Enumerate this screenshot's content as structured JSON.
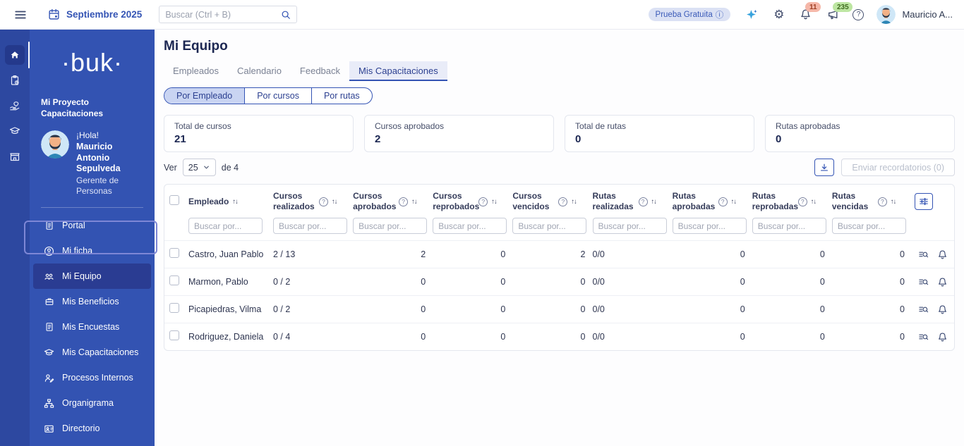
{
  "icons": {
    "sort": "↑↓",
    "help": "?",
    "info": "ⓘ",
    "gear": "⚙"
  },
  "topbar": {
    "date": "Septiembre 2025",
    "search": {
      "placeholder": "Buscar (Ctrl + B)"
    },
    "trial_badge": "Prueba Gratuita",
    "notifications_count": "11",
    "announcements_count": "235",
    "user_name": "Mauricio A..."
  },
  "sidebar": {
    "logo": "·buk·",
    "project_title": "Mi Proyecto Capacitaciones",
    "greeting": "¡Hola!",
    "user_name_line1": "Mauricio Antonio",
    "user_name_line2": "Sepulveda",
    "user_role": "Gerente de Personas",
    "items": [
      {
        "label": "Portal"
      },
      {
        "label": "Mi ficha"
      },
      {
        "label": "Mi Equipo"
      },
      {
        "label": "Mis Beneficios"
      },
      {
        "label": "Mis Encuestas"
      },
      {
        "label": "Mis Capacitaciones"
      },
      {
        "label": "Procesos Internos"
      },
      {
        "label": "Organigrama"
      },
      {
        "label": "Directorio"
      }
    ]
  },
  "main": {
    "page_title": "Mi Equipo",
    "tabs": [
      {
        "label": "Empleados"
      },
      {
        "label": "Calendario"
      },
      {
        "label": "Feedback"
      },
      {
        "label": "Mis Capacitaciones"
      }
    ],
    "view_toggle": [
      {
        "label": "Por Empleado"
      },
      {
        "label": "Por cursos"
      },
      {
        "label": "Por rutas"
      }
    ],
    "stats": [
      {
        "label": "Total de cursos",
        "value": "21"
      },
      {
        "label": "Cursos aprobados",
        "value": "2"
      },
      {
        "label": "Total de rutas",
        "value": "0"
      },
      {
        "label": "Rutas aprobadas",
        "value": "0"
      }
    ],
    "toolbar": {
      "ver_label": "Ver",
      "page_size": "25",
      "total_label": "de 4",
      "send_reminders_label": "Enviar recordatorios (0)"
    },
    "table": {
      "filter_placeholder": "Buscar por...",
      "columns": [
        {
          "label": "Empleado"
        },
        {
          "label": "Cursos realizados"
        },
        {
          "label": "Cursos aprobados"
        },
        {
          "label": "Cursos reprobados"
        },
        {
          "label": "Cursos vencidos"
        },
        {
          "label": "Rutas realizadas"
        },
        {
          "label": "Rutas aprobadas"
        },
        {
          "label": "Rutas reprobadas"
        },
        {
          "label": "Rutas vencidas"
        }
      ],
      "rows": [
        {
          "employee": "Castro, Juan Pablo",
          "cursos_realizados": "2 / 13",
          "cursos_aprobados": "2",
          "cursos_reprobados": "0",
          "cursos_vencidos": "2",
          "rutas_realizadas": "0/0",
          "rutas_aprobadas": "0",
          "rutas_reprobadas": "0",
          "rutas_vencidas": "0"
        },
        {
          "employee": "Marmon, Pablo",
          "cursos_realizados": "0 / 2",
          "cursos_aprobados": "0",
          "cursos_reprobados": "0",
          "cursos_vencidos": "0",
          "rutas_realizadas": "0/0",
          "rutas_aprobadas": "0",
          "rutas_reprobadas": "0",
          "rutas_vencidas": "0"
        },
        {
          "employee": "Picapiedras, Vilma",
          "cursos_realizados": "0 / 2",
          "cursos_aprobados": "0",
          "cursos_reprobados": "0",
          "cursos_vencidos": "0",
          "rutas_realizadas": "0/0",
          "rutas_aprobadas": "0",
          "rutas_reprobadas": "0",
          "rutas_vencidas": "0"
        },
        {
          "employee": "Rodriguez, Daniela",
          "cursos_realizados": "0 / 4",
          "cursos_aprobados": "0",
          "cursos_reprobados": "0",
          "cursos_vencidos": "0",
          "rutas_realizadas": "0/0",
          "rutas_aprobadas": "0",
          "rutas_reprobadas": "0",
          "rutas_vencidas": "0"
        }
      ]
    }
  }
}
